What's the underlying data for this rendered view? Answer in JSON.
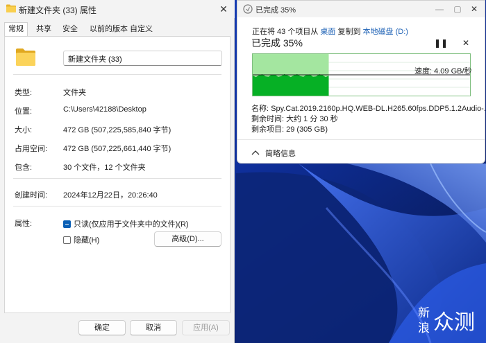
{
  "properties": {
    "title": "新建文件夹 (33) 属性",
    "tabs": [
      "常规",
      "共享",
      "安全",
      "以前的版本",
      "自定义"
    ],
    "name_value": "新建文件夹 (33)",
    "rows": {
      "type": {
        "label": "类型:",
        "value": "文件夹"
      },
      "location": {
        "label": "位置:",
        "value": "C:\\Users\\42188\\Desktop"
      },
      "size": {
        "label": "大小:",
        "value": "472 GB (507,225,585,840 字节)"
      },
      "size_on_disk": {
        "label": "占用空间:",
        "value": "472 GB (507,225,661,440 字节)"
      },
      "contains": {
        "label": "包含:",
        "value": "30 个文件，12 个文件夹"
      },
      "created": {
        "label": "创建时间:",
        "value": "2024年12月22日，20:26:40"
      },
      "attributes": {
        "label": "属性:"
      }
    },
    "readonly_label": "只读(仅应用于文件夹中的文件)(R)",
    "hidden_label": "隐藏(H)",
    "advanced_label": "高级(D)...",
    "ok_label": "确定",
    "cancel_label": "取消",
    "apply_label": "应用(A)",
    "close_glyph": "✕"
  },
  "copy_dialog": {
    "title": "已完成 35%",
    "status_prefix": "正在将 43 个项目从",
    "source_link": "桌面",
    "status_middle": "复制到",
    "dest_link": "本地磁盘 (D:)",
    "percent_title": "已完成 35%",
    "pause_glyph": "❚❚",
    "cancel_glyph": "✕",
    "minimize_glyph": "—",
    "maximize_glyph": "▢",
    "close_glyph": "✕",
    "speed": "速度: 4.09 GB/秒",
    "progress_fraction": 0.35,
    "name": "名称: Spy.Cat.2019.2160p.HQ.WEB-DL.H265.60fps.DDP5.1.2Audio-...",
    "time_remaining": "剩余时间: 大约 1 分 30 秒",
    "items_remaining": "剩余项目: 29 (305 GB)",
    "less_info": "简略信息"
  },
  "watermark": {
    "line1": "新",
    "line2": "浪",
    "brand": "众测"
  },
  "colors": {
    "progress_green": "#06b025",
    "progress_light": "#a4e6a0",
    "link_blue": "#1a5fb4",
    "accent_blue": "#0a5fb5",
    "wallpaper_deep": "#0a1c4a"
  }
}
